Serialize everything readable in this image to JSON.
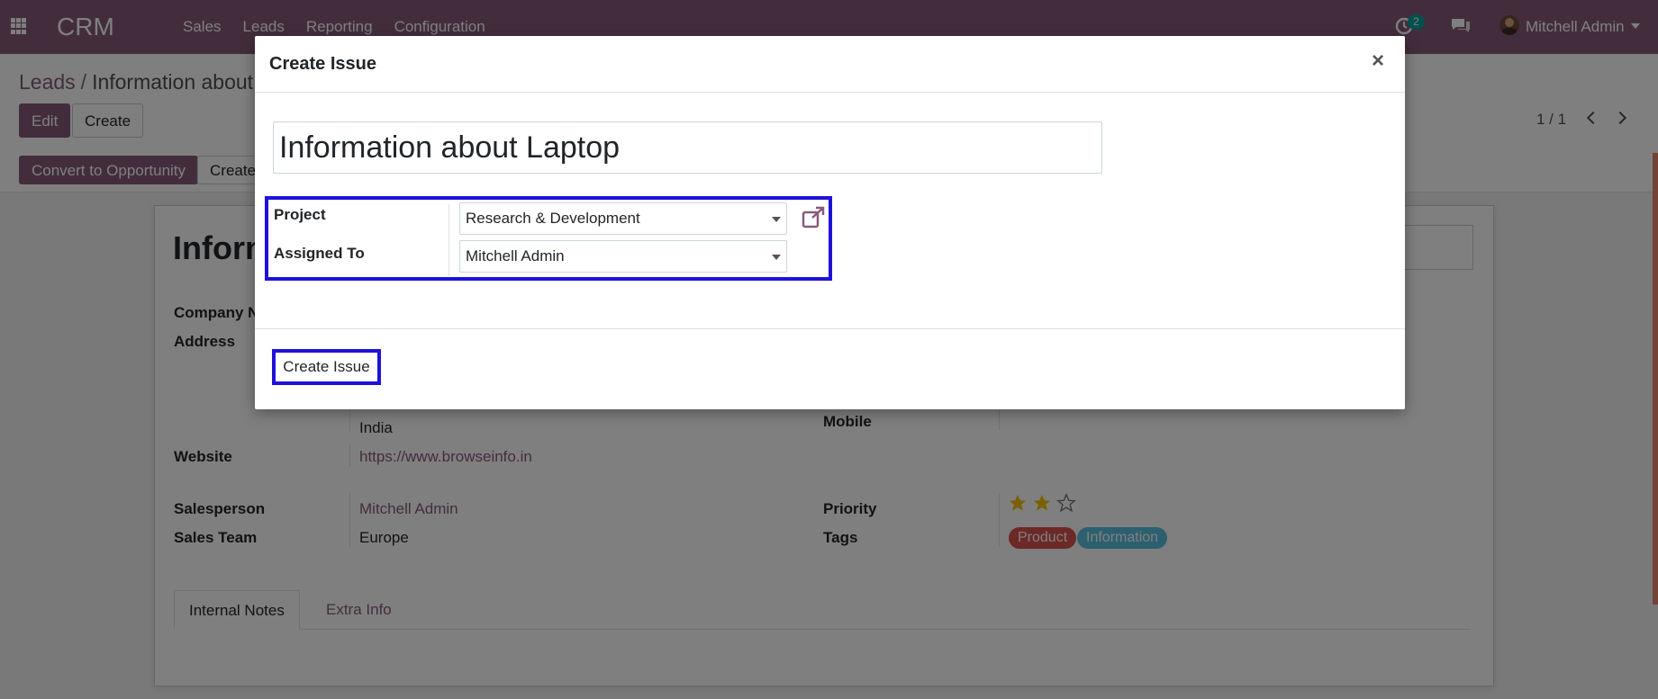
{
  "navbar": {
    "brand": "CRM",
    "menu": [
      "Sales",
      "Leads",
      "Reporting",
      "Configuration"
    ],
    "activity_count": "2",
    "user_name": "Mitchell Admin"
  },
  "breadcrumb": {
    "parent": "Leads",
    "separator": "/",
    "current": "Information about Laptop"
  },
  "control_panel": {
    "edit_label": "Edit",
    "create_label": "Create",
    "pager": "1 / 1"
  },
  "statusbar": {
    "convert_label": "Convert to Opportunity",
    "create_label": "Create"
  },
  "form": {
    "title": "Information about Laptop",
    "company_label": "Company Name",
    "address_label": "Address",
    "address_country": "India",
    "website_label": "Website",
    "website_value": "https://www.browseinfo.in",
    "mobile_label": "Mobile",
    "salesperson_label": "Salesperson",
    "salesperson_value": "Mitchell Admin",
    "sales_team_label": "Sales Team",
    "sales_team_value": "Europe",
    "priority_label": "Priority",
    "priority_stars": 2,
    "priority_max": 3,
    "tags_label": "Tags",
    "tags": [
      {
        "label": "Product",
        "color": "#d9534f"
      },
      {
        "label": "Information",
        "color": "#5bc0de"
      }
    ],
    "tabs": [
      "Internal Notes",
      "Extra Info"
    ]
  },
  "modal": {
    "title": "Create Issue",
    "close_symbol": "×",
    "name_value": "Information about Laptop",
    "project_label": "Project",
    "project_value": "Research & Development",
    "assigned_label": "Assigned To",
    "assigned_value": "Mitchell Admin",
    "submit_label": "Create Issue"
  },
  "colors": {
    "brand": "#875a7b",
    "highlight": "#1f12d8",
    "activity_badge": "#00a09d",
    "star_filled": "#f3c000"
  }
}
